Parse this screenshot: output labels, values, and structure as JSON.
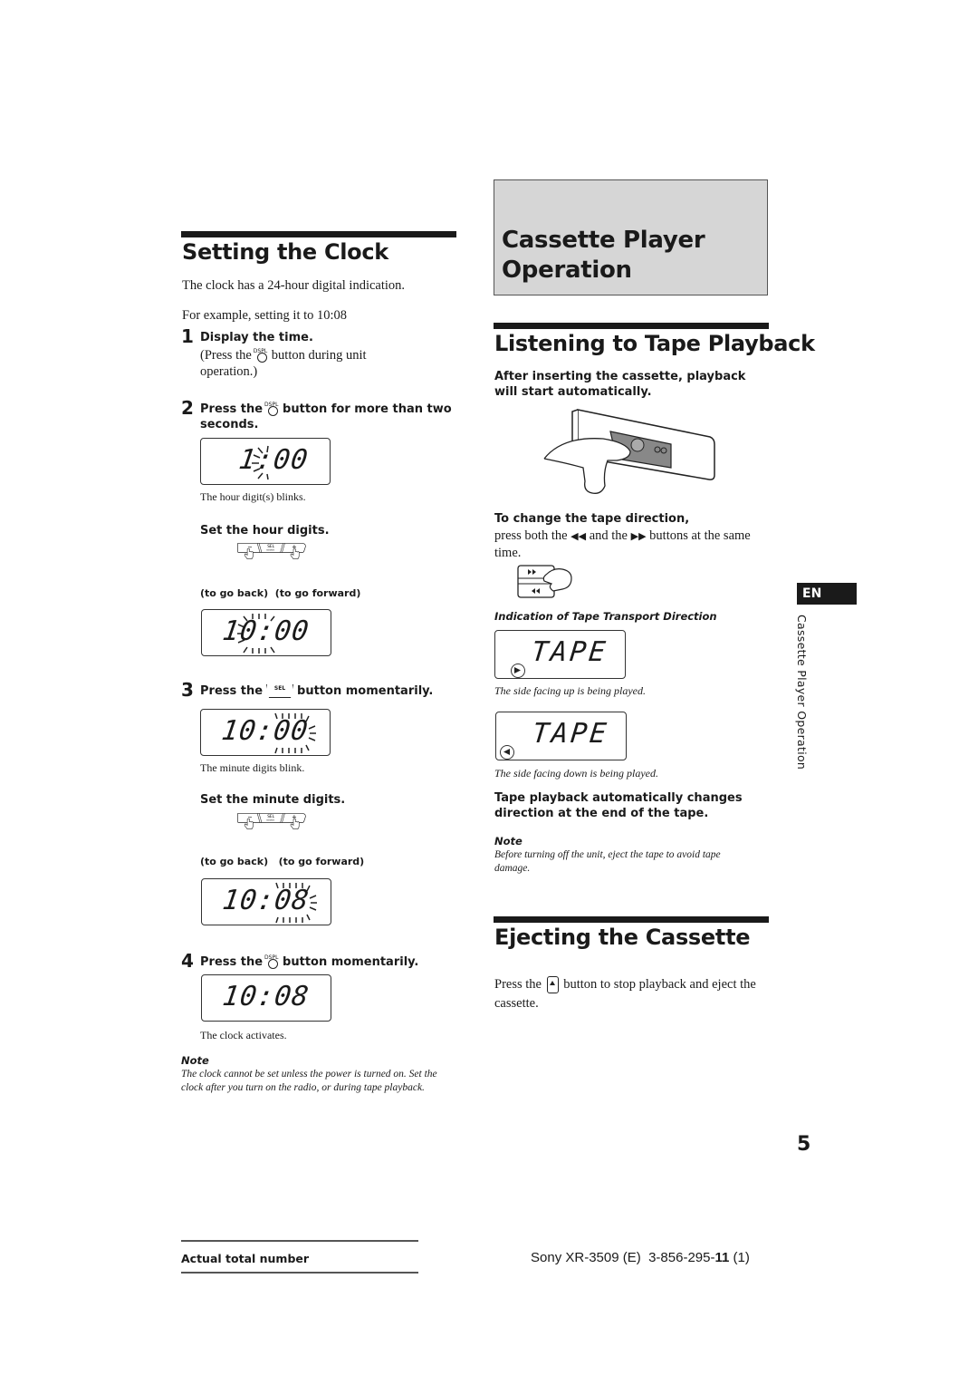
{
  "clock": {
    "title": "Setting the Clock",
    "intro": "The clock has a 24-hour digital indication.",
    "example": "For example, setting it to 10:08",
    "button_dspl_label": "DSPL",
    "button_sel_label": "SEL",
    "steps": [
      {
        "num": "1",
        "bold": "Display the time.",
        "text_before": "(Press the",
        "text_after": "button during  unit",
        "text_line2": "operation.)"
      },
      {
        "num": "2",
        "bold_before": "Press the",
        "bold_after": "button for more than two",
        "bold_line2": "seconds."
      },
      {
        "num": "3",
        "bold_before": "Press the",
        "bold_after": "button momentarily."
      },
      {
        "num": "4",
        "bold_before": "Press the",
        "bold_after": "button momentarily."
      }
    ],
    "displays": [
      {
        "digits": "1:00",
        "blinking": "hour",
        "caption": "The hour digit(s) blinks."
      },
      {
        "digits": "10:00",
        "blinking": "hour",
        "caption": ""
      },
      {
        "digits": "10:00",
        "blinking": "minute",
        "caption": "The minute digits blink."
      },
      {
        "digits": "10:08",
        "blinking": "minute",
        "caption": ""
      },
      {
        "digits": "10:08",
        "blinking": "none",
        "caption": "The clock activates."
      }
    ],
    "set_hour": "Set the hour digits.",
    "set_minute": "Set the minute digits.",
    "rocker_minus": "−",
    "rocker_plus": "+",
    "go_back": "(to go back)",
    "go_forward": "(to go forward)",
    "note_heading": "Note",
    "note_text": "The clock cannot be set unless the power is turned on. Set the clock after you turn on the radio, or during tape playback."
  },
  "cassette": {
    "chapter_title_line1": "Cassette Player",
    "chapter_title_line2": "Operation",
    "listening_title": "Listening to Tape Playback",
    "listening_bold": "After inserting the cassette, playback will start automatically.",
    "change_dir_heading": "To change the tape direction,",
    "change_dir_before": "press both the",
    "change_dir_mid": "and the",
    "change_dir_after": "buttons at the same time.",
    "indication_heading": "Indication of Tape Transport Direction",
    "tape_displays": [
      {
        "text": "TAPE",
        "direction": "forward",
        "caption": "The side facing up is being played."
      },
      {
        "text": "TAPE",
        "direction": "reverse",
        "caption": "The side facing down is being played."
      }
    ],
    "auto_reverse": "Tape playback automatically changes direction at the end of the tape.",
    "note_heading": "Note",
    "note_text": "Before turning off the unit, eject the tape to avoid tape damage.",
    "eject_title": "Ejecting the Cassette",
    "eject_before": "Press the",
    "eject_after": "button to stop playback and eject the cassette."
  },
  "side_tab": {
    "lang": "EN",
    "section": "Cassette Player Operation"
  },
  "footer": {
    "page_number": "5",
    "left": "Actual total number",
    "model": "Sony XR-3509 (E)",
    "part_prefix": "3-856-295-",
    "part_bold": "11",
    "part_suffix": " (1)"
  }
}
